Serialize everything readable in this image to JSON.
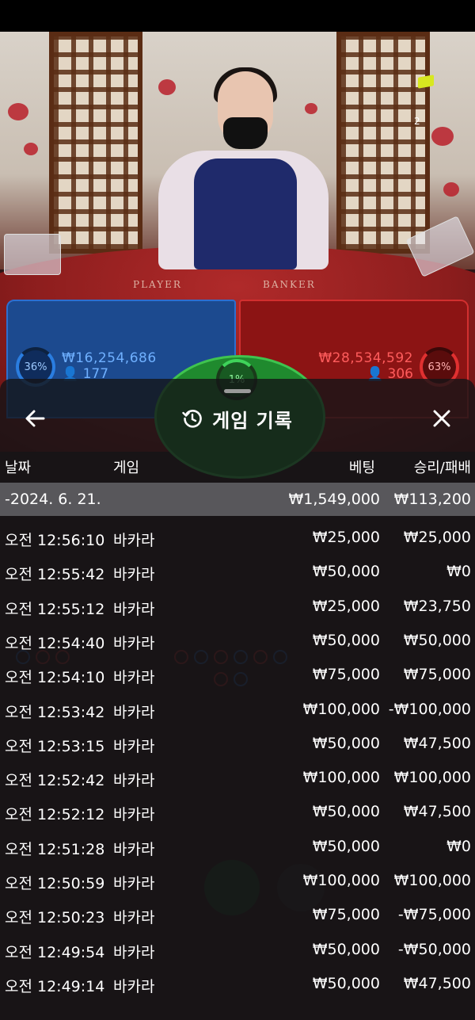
{
  "stream": {
    "viewer_badge": "2",
    "table_labels": {
      "player": "PLAYER",
      "banker": "BANKER"
    },
    "player": {
      "percent": "36%",
      "amount": "₩16,254,686",
      "bettors": "177"
    },
    "banker": {
      "percent": "63%",
      "amount": "₩28,534,592",
      "bettors": "306"
    },
    "tie": {
      "percent": "1%"
    }
  },
  "history": {
    "title": "게임 기록",
    "columns": {
      "date": "날짜",
      "game": "게임",
      "bet": "베팅",
      "result": "승리/패배"
    },
    "summary": {
      "date": "-2024. 6. 21.",
      "bet": "₩1,549,000",
      "result": "₩113,200"
    },
    "rows": [
      {
        "time": "오전 12:56:10",
        "game": "바카라",
        "bet": "₩25,000",
        "result": "₩25,000"
      },
      {
        "time": "오전 12:55:42",
        "game": "바카라",
        "bet": "₩50,000",
        "result": "₩0"
      },
      {
        "time": "오전 12:55:12",
        "game": "바카라",
        "bet": "₩25,000",
        "result": "₩23,750"
      },
      {
        "time": "오전 12:54:40",
        "game": "바카라",
        "bet": "₩50,000",
        "result": "₩50,000"
      },
      {
        "time": "오전 12:54:10",
        "game": "바카라",
        "bet": "₩75,000",
        "result": "₩75,000"
      },
      {
        "time": "오전 12:53:42",
        "game": "바카라",
        "bet": "₩100,000",
        "result": "-₩100,000"
      },
      {
        "time": "오전 12:53:15",
        "game": "바카라",
        "bet": "₩50,000",
        "result": "₩47,500"
      },
      {
        "time": "오전 12:52:42",
        "game": "바카라",
        "bet": "₩100,000",
        "result": "₩100,000"
      },
      {
        "time": "오전 12:52:12",
        "game": "바카라",
        "bet": "₩50,000",
        "result": "₩47,500"
      },
      {
        "time": "오전 12:51:28",
        "game": "바카라",
        "bet": "₩50,000",
        "result": "₩0"
      },
      {
        "time": "오전 12:50:59",
        "game": "바카라",
        "bet": "₩100,000",
        "result": "₩100,000"
      },
      {
        "time": "오전 12:50:23",
        "game": "바카라",
        "bet": "₩75,000",
        "result": "-₩75,000"
      },
      {
        "time": "오전 12:49:54",
        "game": "바카라",
        "bet": "₩50,000",
        "result": "-₩50,000"
      },
      {
        "time": "오전 12:49:14",
        "game": "바카라",
        "bet": "₩50,000",
        "result": "₩47,500"
      }
    ]
  },
  "icons": {
    "back": "arrow-left-icon",
    "history": "history-clock-icon",
    "close": "close-icon"
  },
  "colors": {
    "player_blue": "#1c4a8f",
    "banker_red": "#8c1414",
    "tie_green": "#1f8a2e",
    "sheet_bg": "#141416"
  }
}
